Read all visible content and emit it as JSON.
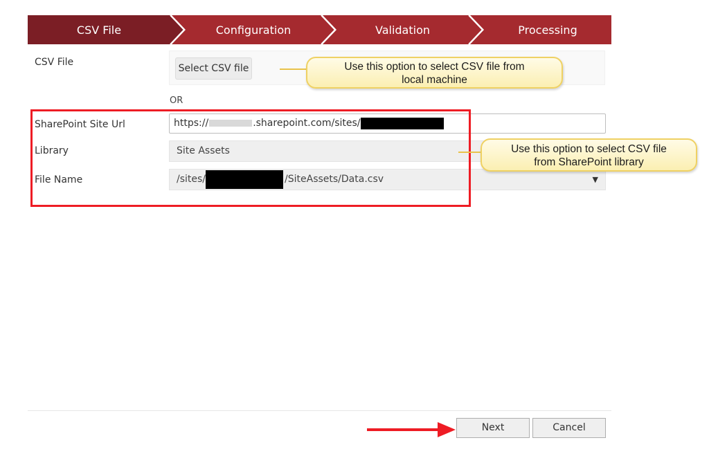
{
  "wizard": {
    "steps": [
      {
        "label": "CSV File",
        "active": true
      },
      {
        "label": "Configuration",
        "active": false
      },
      {
        "label": "Validation",
        "active": false
      },
      {
        "label": "Processing",
        "active": false
      }
    ],
    "colors": {
      "active": "#7b1e25",
      "inactive": "#a52a2f"
    }
  },
  "form": {
    "csv_file_label": "CSV File",
    "select_button": "Select CSV file",
    "or_text": "OR",
    "site_url_label": "SharePoint Site Url",
    "site_url_prefix": "https://",
    "site_url_mid": ".sharepoint.com/sites/",
    "library_label": "Library",
    "library_value": "Site Assets",
    "file_name_label": "File Name",
    "file_name_prefix": "/sites/",
    "file_name_suffix": "/SiteAssets/Data.csv",
    "dropdown_caret": "▼"
  },
  "callouts": {
    "local": "Use this option to select CSV file from local machine",
    "sharepoint": "Use this option to select CSV file from SharePoint library"
  },
  "footer": {
    "next": "Next",
    "cancel": "Cancel"
  },
  "annotation_color": "#ee1c24"
}
